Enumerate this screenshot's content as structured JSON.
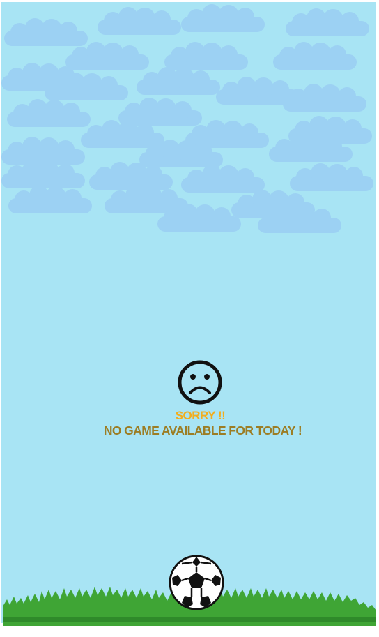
{
  "screen": {
    "status_title": "SORRY !!",
    "status_message": "NO GAME AVAILABLE FOR TODAY !"
  },
  "colors": {
    "sky": "#a8e4f4",
    "clouds": "#9bcff3",
    "sorry_text": "#f2ad1d",
    "message_text": "#9c7d24",
    "grass": "#3fa535",
    "grass_dark": "#2f8a2a"
  },
  "icons": {
    "status_icon": "sad-face-icon",
    "decoration": "soccer-ball-icon"
  }
}
